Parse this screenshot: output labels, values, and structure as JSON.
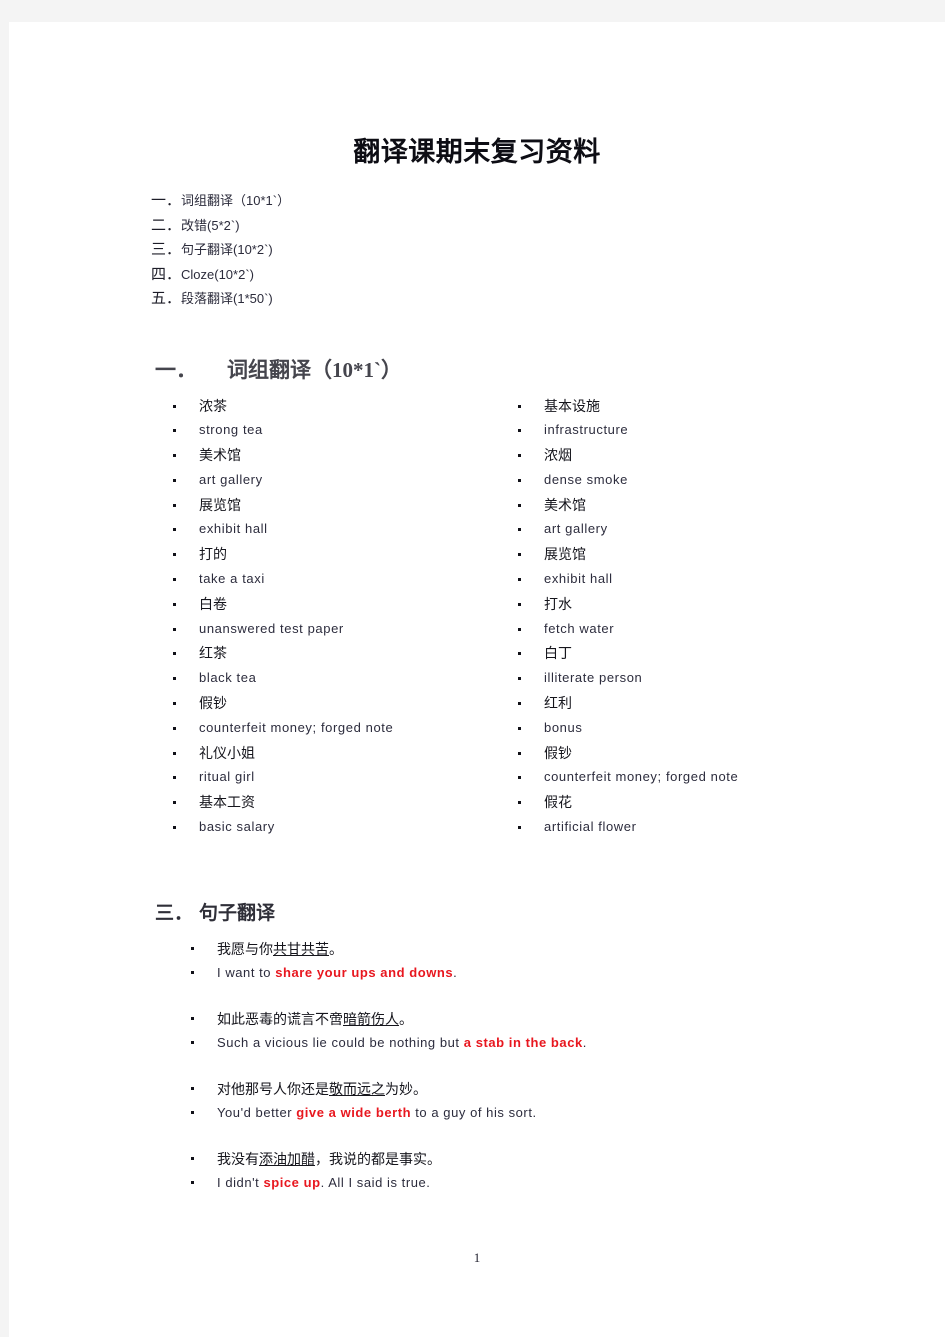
{
  "document": {
    "title": "翻译课期末复习资料",
    "page_number": "1"
  },
  "toc": {
    "items": [
      {
        "num": "一．",
        "label": "词组翻译（10*1`）"
      },
      {
        "num": "二．",
        "label": "改错(5*2`)"
      },
      {
        "num": "三．",
        "label": "句子翻译(10*2`)"
      },
      {
        "num": "四．",
        "label": "Cloze(10*2`)"
      },
      {
        "num": "五．",
        "label": "段落翻译(1*50`)"
      }
    ]
  },
  "section_one": {
    "num": "一．",
    "heading": "词组翻译（10*1`）",
    "left_column": [
      {
        "type": "zh",
        "text": "浓茶"
      },
      {
        "type": "en",
        "text": "strong tea"
      },
      {
        "type": "zh",
        "text": "美术馆"
      },
      {
        "type": "en",
        "text": "art gallery"
      },
      {
        "type": "zh",
        "text": "展览馆"
      },
      {
        "type": "en",
        "text": "exhibit hall"
      },
      {
        "type": "zh",
        "text": "打的"
      },
      {
        "type": "en",
        "text": "take a taxi"
      },
      {
        "type": "zh",
        "text": "白卷"
      },
      {
        "type": "en",
        "text": "unanswered test paper"
      },
      {
        "type": "zh",
        "text": "红茶"
      },
      {
        "type": "en",
        "text": "black tea"
      },
      {
        "type": "zh",
        "text": "假钞"
      },
      {
        "type": "en",
        "text": "counterfeit money; forged note"
      },
      {
        "type": "zh",
        "text": "礼仪小姐"
      },
      {
        "type": "en",
        "text": "ritual girl"
      },
      {
        "type": "zh",
        "text": "基本工资"
      },
      {
        "type": "en",
        "text": "basic salary"
      }
    ],
    "right_column": [
      {
        "type": "zh",
        "text": "基本设施"
      },
      {
        "type": "en",
        "text": "infrastructure"
      },
      {
        "type": "zh",
        "text": "浓烟"
      },
      {
        "type": "en",
        "text": "dense smoke"
      },
      {
        "type": "zh",
        "text": "美术馆"
      },
      {
        "type": "en",
        "text": "art gallery"
      },
      {
        "type": "zh",
        "text": "展览馆"
      },
      {
        "type": "en",
        "text": "exhibit hall"
      },
      {
        "type": "zh",
        "text": "打水"
      },
      {
        "type": "en",
        "text": "fetch water"
      },
      {
        "type": "zh",
        "text": "白丁"
      },
      {
        "type": "en",
        "text": "illiterate person"
      },
      {
        "type": "zh",
        "text": "红利"
      },
      {
        "type": "en",
        "text": "bonus"
      },
      {
        "type": "zh",
        "text": "假钞"
      },
      {
        "type": "en",
        "text": "counterfeit money; forged note"
      },
      {
        "type": "zh",
        "text": "假花"
      },
      {
        "type": "en",
        "text": "artificial flower"
      }
    ]
  },
  "section_three": {
    "num": "三．",
    "heading": "句子翻译",
    "pairs": [
      {
        "zh_pre": "我愿与你",
        "zh_underline": "共甘共苦",
        "zh_post": "。",
        "en_pre": "I want to ",
        "en_highlight": "share your ups and downs",
        "en_post": "."
      },
      {
        "zh_pre": "如此恶毒的谎言不啻",
        "zh_underline": "暗箭伤人",
        "zh_post": "。",
        "en_pre": "Such a vicious lie could be nothing but ",
        "en_highlight": "a stab in the back",
        "en_post": "."
      },
      {
        "zh_pre": "对他那号人你还是",
        "zh_underline": "敬而远之",
        "zh_post": "为妙。",
        "en_pre": "You'd better ",
        "en_highlight": "give a wide berth",
        "en_post": " to a guy of his sort."
      },
      {
        "zh_pre": "我没有",
        "zh_underline": "添油加醋",
        "zh_post": "，我说的都是事实。",
        "en_pre": "I didn't ",
        "en_highlight": "spice up",
        "en_post": ". All I said is true."
      }
    ]
  },
  "colors": {
    "page_background": "#f4f4f4",
    "page": "#ffffff",
    "body_text": "#2c2c3d",
    "heading_gray": "#45454d",
    "highlight_red": "#e8171f"
  }
}
